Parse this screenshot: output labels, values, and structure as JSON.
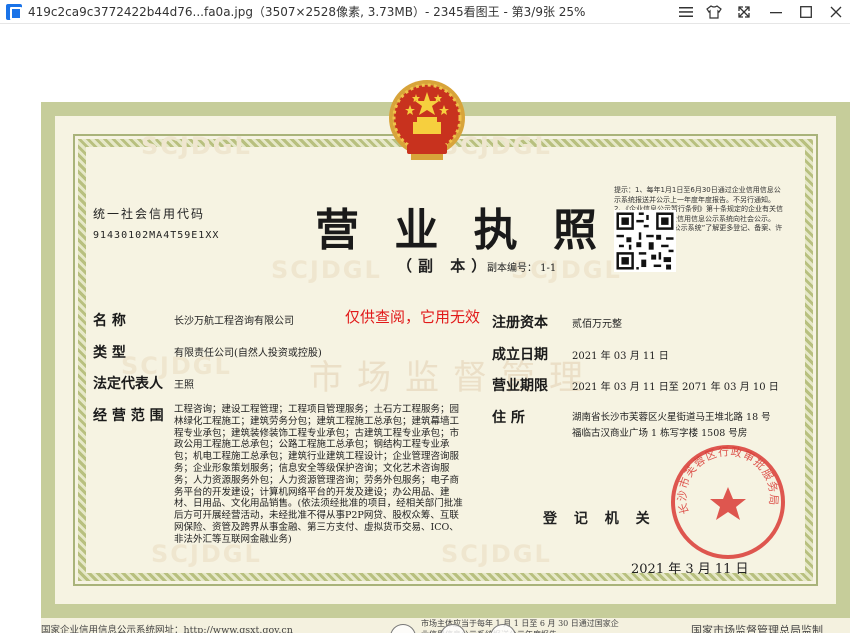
{
  "window": {
    "title": "419c2ca9c3772422b44d76...fa0a.jpg（3507×2528像素, 3.73MB）- 2345看图王 - 第3/9张 25%"
  },
  "license": {
    "credit_code_label": "统一社会信用代码",
    "credit_code": "91430102MA4T59E1XX",
    "title": "营 业 执 照",
    "subtitle": "（副 本）",
    "copy_number": "副本编号：  1-1",
    "watermark": "SCJDGL",
    "watermark_center": "市场监督管理",
    "qr_note": "提示：1、每年1月1日至6月30日通过企业信用信息公示系统报送并公示上一年度年度报告。不另行通知。2、《企业信息公示暂行条例》第十条规定的企业有关信息工作日内通过企业信用信息公示系统向社会公示。  “国家企业信用信息公示系统”了解更多登记、备案、许可、监管信息。",
    "fields": {
      "name_label": "名        称",
      "name_value": "长沙万航工程咨询有限公司",
      "type_label": "类        型",
      "type_value": "有限责任公司(自然人投资或控股)",
      "legal_rep_label": "法定代表人",
      "legal_rep_value": "王照",
      "scope_label": "经 营 范 围",
      "scope_value": "工程咨询；建设工程管理；工程项目管理服务；土石方工程服务；园林绿化工程施工；建筑劳务分包；建筑工程施工总承包；建筑幕墙工程专业承包；建筑装修装饰工程专业承包；古建筑工程专业承包；市政公用工程施工总承包；公路工程施工总承包；钢结构工程专业承包；机电工程施工总承包；建筑行业建筑工程设计；企业管理咨询服务；企业形象策划服务；信息安全等级保护咨询；文化艺术咨询服务；人力资源服务外包；人力资源管理咨询；劳务外包服务；电子商务平台的开发建设；计算机网络平台的开发及建设；办公用品、建材、日用品、文化用品销售。(依法须经批准的项目，经相关部门批准后方可开展经营活动，未经批准不得从事P2P网贷、股权众筹、互联网保险、资管及跨界从事金融、第三方支付、虚拟货币交易、ICO、非法外汇等互联网金融业务)",
      "capital_label": "注册资本",
      "capital_value": "贰佰万元整",
      "established_label": "成立日期",
      "established_value": "2021 年 03 月 11 日",
      "term_label": "营业期限",
      "term_value": "2021 年 03 月 11 日至 2071 年 03 月 10 日",
      "address_label": "住        所",
      "address_value": "湖南省长沙市芙蓉区火星街道马王堆北路 18 号福临古汉商业广场 1 栋写字楼 1508 号房"
    },
    "overlay_note": "仅供查阅，它用无效",
    "registration_label": "登 记 机 关",
    "seal_text": "长沙市芙蓉区行政审批服务局",
    "issue_date": "2021 年   3  月   11  日",
    "footer_left": "国家企业信用信息公示系统网址：http://www.gsxt.gov.cn",
    "footer_mid": "市场主体应当于每年 1 月 1 日至 6 月 30 日通过国家企业信用信息公示系统报送公示年度报告",
    "footer_right": "国家市场监督管理总局监制"
  },
  "icons": [
    "app-icon",
    "menu-icon",
    "skin-icon",
    "mini-icon",
    "minimize-icon",
    "maximize-icon",
    "close-icon"
  ],
  "colors": {
    "frame": "#c6cd9a",
    "paper": "#f6f3e2",
    "seal_red": "#d93a35",
    "note_red": "#e11919"
  }
}
